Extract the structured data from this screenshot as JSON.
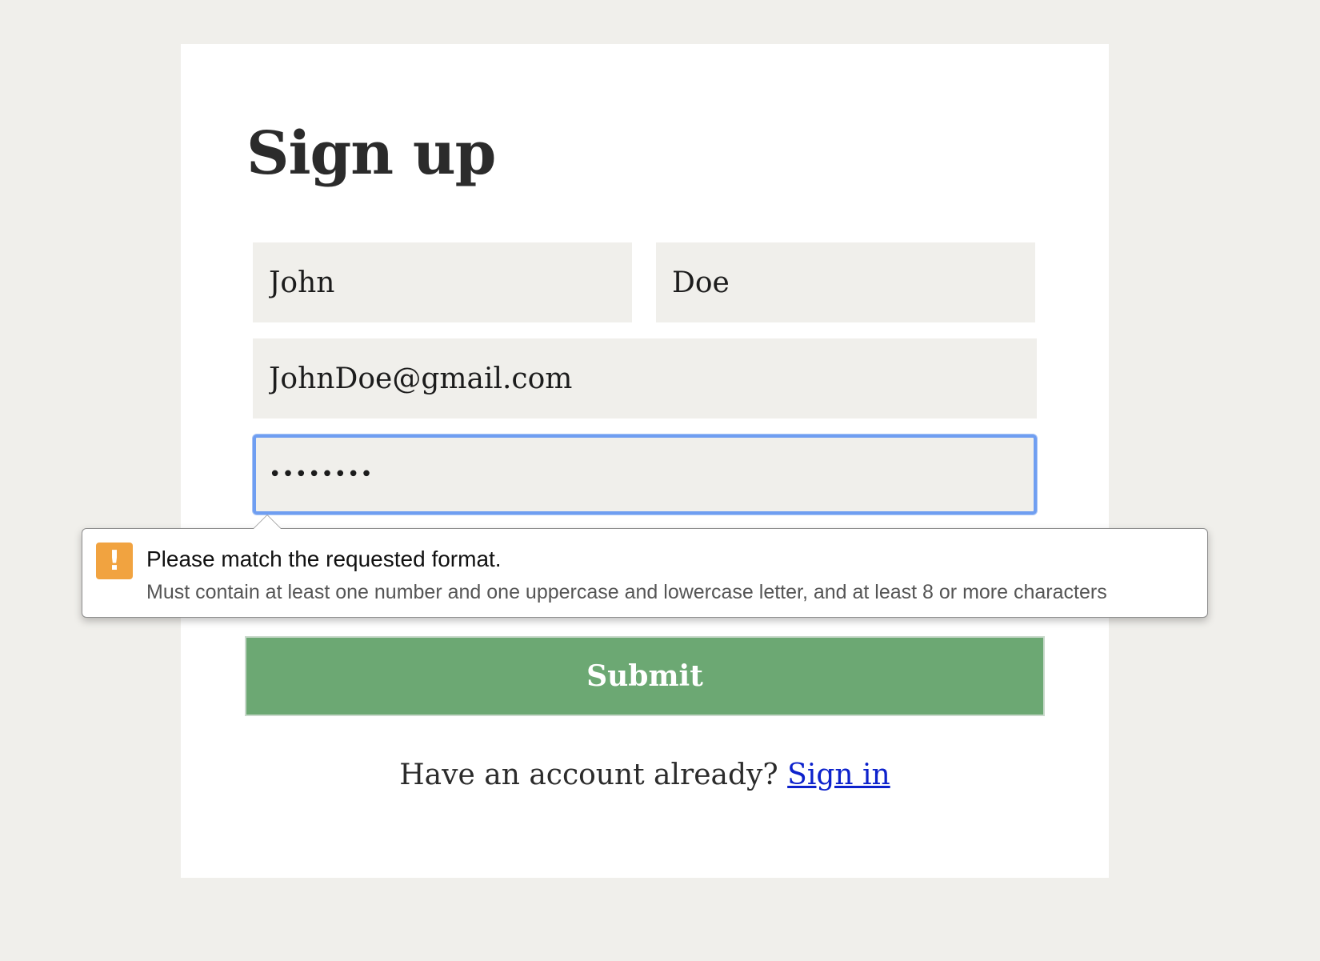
{
  "form": {
    "title": "Sign up",
    "first_name": "John",
    "last_name": "Doe",
    "email": "JohnDoe@gmail.com",
    "password_masked": "••••••••",
    "submit_label": "Submit"
  },
  "validation": {
    "icon": "warning-icon",
    "icon_glyph": "!",
    "message": "Please match the requested format.",
    "detail": "Must contain at least one number and one uppercase and lowercase letter, and at least 8 or more characters"
  },
  "footer": {
    "prompt": "Have an account already?",
    "link_label": "Sign in"
  },
  "colors": {
    "background": "#f0efeb",
    "submit": "#6ca873",
    "focus_ring": "#6f9ef1",
    "warning": "#f1a340",
    "link": "#0d22cc"
  }
}
